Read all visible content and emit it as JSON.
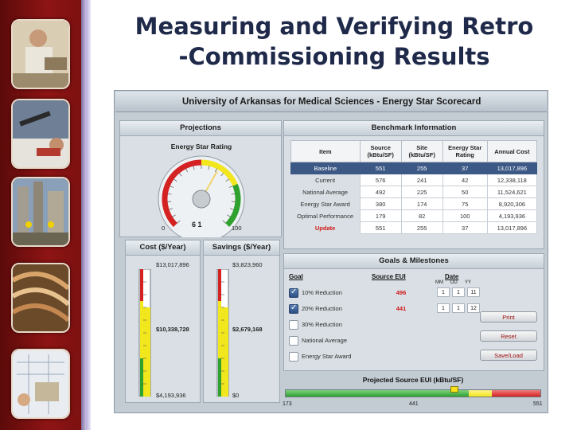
{
  "slide": {
    "title_line1": "Measuring and Verifying Retro",
    "title_line2": "-Commissioning Results"
  },
  "app": {
    "title": "University of Arkansas for Medical Sciences - Energy Star Scorecard",
    "projections": {
      "title": "Projections",
      "gauge_title": "Energy Star Rating",
      "gauge_value": 61,
      "gauge_min": "0",
      "gauge_max": "100",
      "gauge_readout": "6 1"
    },
    "cost": {
      "title": "Cost ($/Year)",
      "top_label": "$13,017,896",
      "current_label": "$10,338,728",
      "bottom_label": "$4,193,936",
      "fill_fraction": 0.7
    },
    "savings": {
      "title": "Savings ($/Year)",
      "top_label": "$3,823,960",
      "current_label": "$2,679,168",
      "bottom_label": "$0",
      "fill_fraction": 0.7
    },
    "benchmark": {
      "title": "Benchmark Information",
      "headers": [
        "Item",
        "Source (kBtu/SF)",
        "Site (kBtu/SF)",
        "Energy Star Rating",
        "Annual Cost"
      ],
      "rows": [
        {
          "item": "Baseline",
          "source": "551",
          "site": "255",
          "rating": "37",
          "cost": "13,017,896",
          "selected": true
        },
        {
          "item": "Current",
          "source": "576",
          "site": "241",
          "rating": "42",
          "cost": "12,338,118",
          "selected": false
        },
        {
          "item": "National Average",
          "source": "492",
          "site": "225",
          "rating": "50",
          "cost": "11,524,621",
          "selected": false
        },
        {
          "item": "Energy Star Award",
          "source": "380",
          "site": "174",
          "rating": "75",
          "cost": "8,920,306",
          "selected": false
        },
        {
          "item": "Optimal Performance",
          "source": "179",
          "site": "82",
          "rating": "100",
          "cost": "4,193,936",
          "selected": false
        },
        {
          "item": "Update",
          "source": "551",
          "site": "255",
          "rating": "37",
          "cost": "13,017,896",
          "selected": false,
          "update": true
        }
      ]
    },
    "goals": {
      "title": "Goals & Milestones",
      "col_goal": "Goal",
      "col_source": "Source EUI",
      "col_date": "Date",
      "date_sub": [
        "MM",
        "DD",
        "YY"
      ],
      "items": [
        {
          "label": "10% Reduction",
          "checked": true,
          "value": "496",
          "mm": "1",
          "dd": "1",
          "yy": "11"
        },
        {
          "label": "20% Reduction",
          "checked": true,
          "value": "441",
          "mm": "1",
          "dd": "1",
          "yy": "12"
        },
        {
          "label": "30% Reduction",
          "checked": false,
          "value": ""
        },
        {
          "label": "National Average",
          "checked": false,
          "value": ""
        },
        {
          "label": "Energy Star Award",
          "checked": false,
          "value": ""
        }
      ],
      "buttons": {
        "print": "Print",
        "reset": "Reset",
        "save_load": "Save/Load"
      }
    },
    "projected": {
      "title": "Projected Source EUI (kBtu/SF)",
      "min": "173",
      "mid": "441",
      "max": "551",
      "marker_fraction": 0.66
    },
    "colors": {
      "green": "#2ea12e",
      "yellow": "#f2e61c",
      "red": "#d42222",
      "selected_row": "#3c5985"
    }
  }
}
